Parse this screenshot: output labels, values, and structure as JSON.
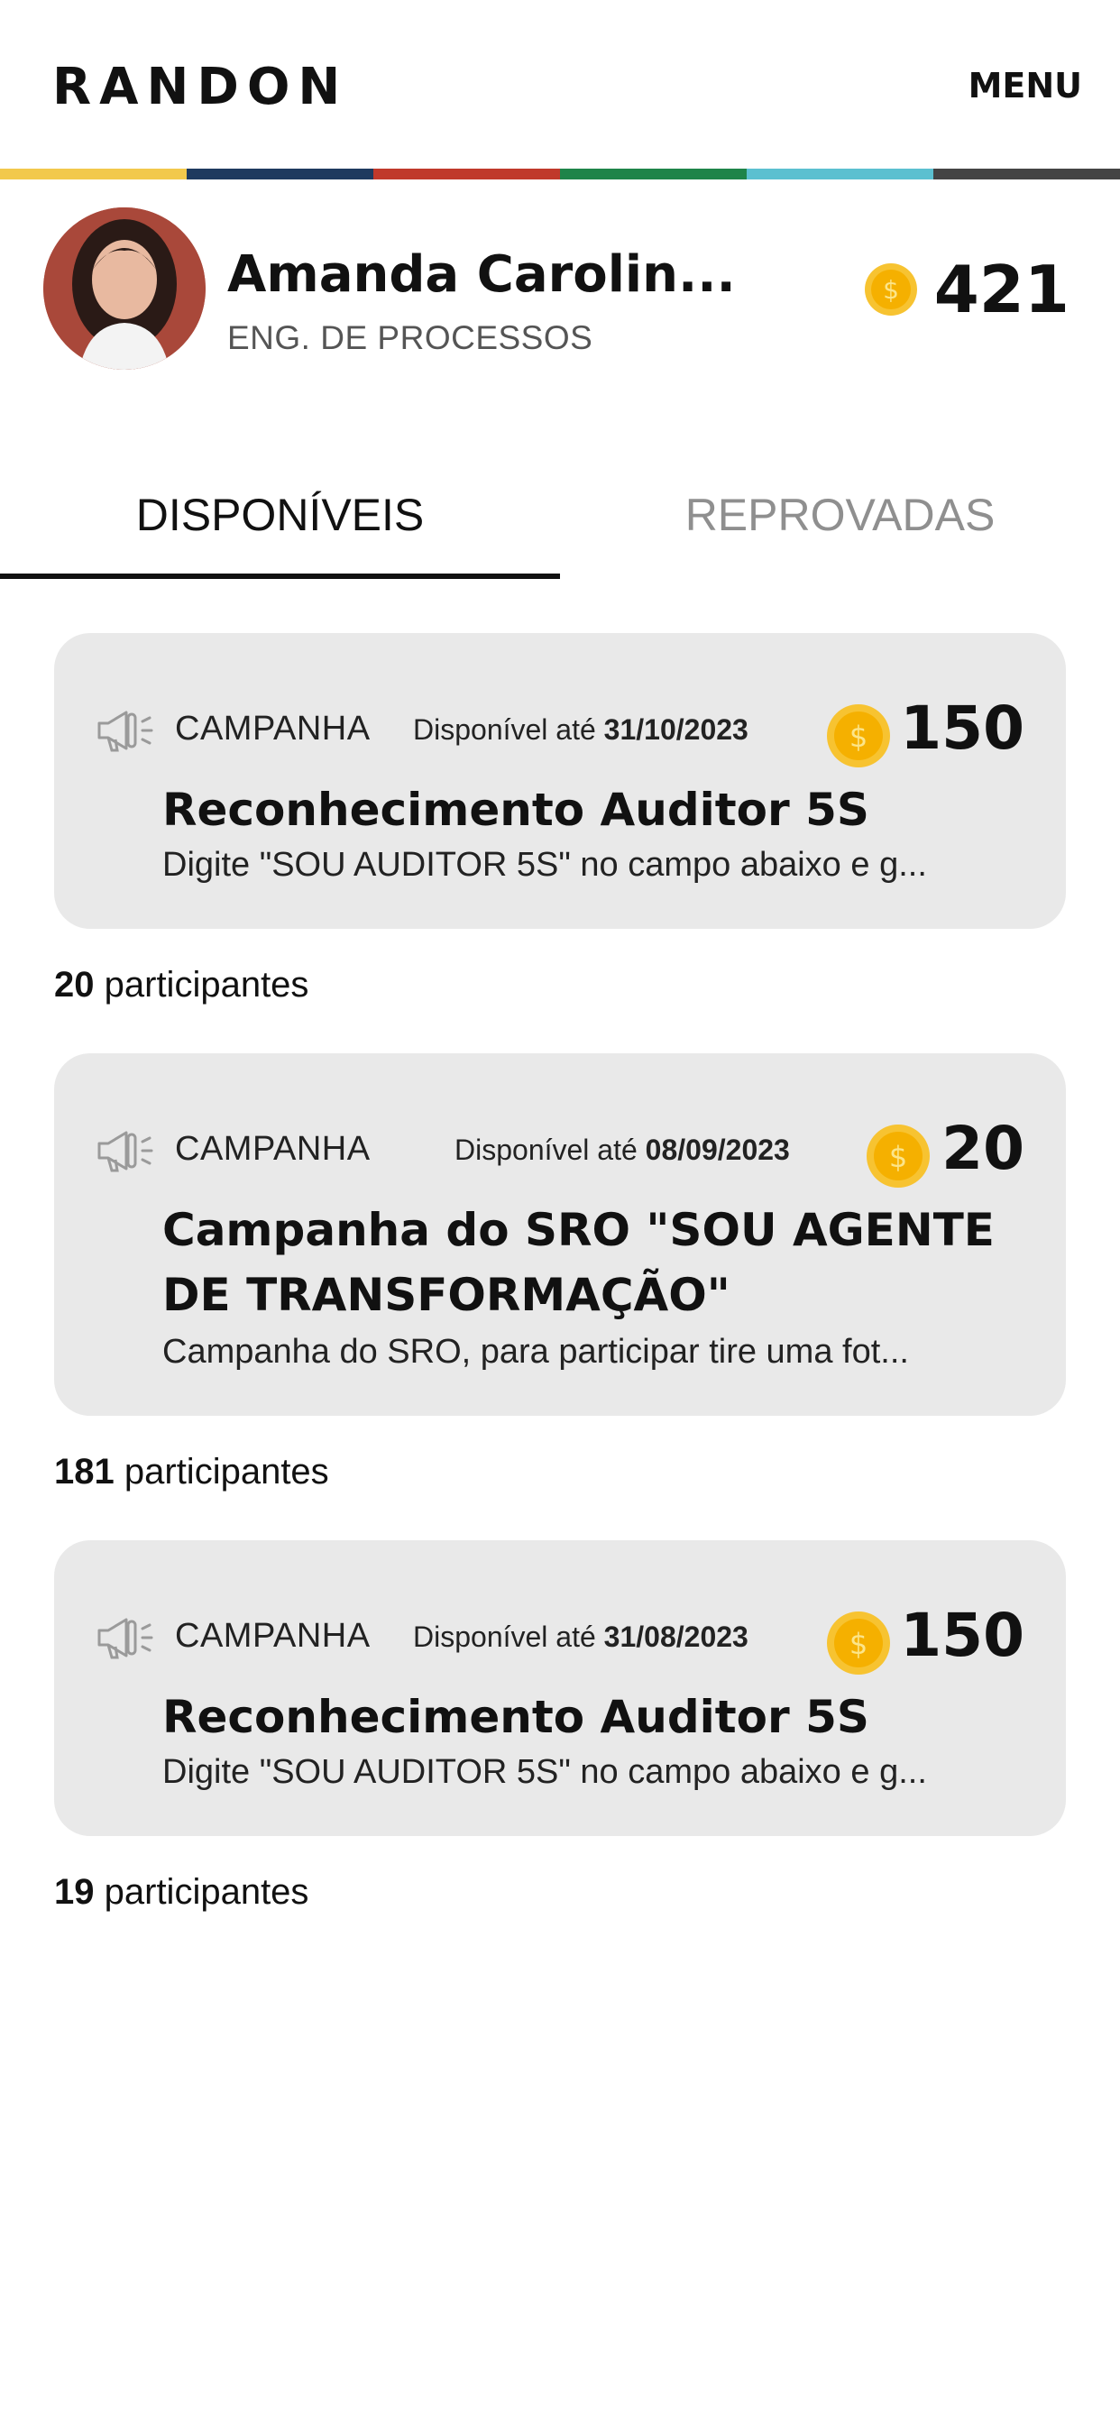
{
  "header": {
    "logo_text": "RANDON",
    "menu_label": "MENU",
    "color_bar": [
      "#f2c94c",
      "#1e3a5f",
      "#c0392b",
      "#1e8449",
      "#5bc0d0",
      "#444444"
    ]
  },
  "profile": {
    "name": "Amanda Carolin...",
    "role": "ENG. DE PROCESSOS",
    "coin_balance": "421"
  },
  "tabs": [
    {
      "label": "DISPONÍVEIS",
      "active": true
    },
    {
      "label": "REPROVADAS",
      "active": false
    }
  ],
  "campaigns": [
    {
      "type": "CAMPANHA",
      "available_prefix": "Disponível até",
      "available_date": "31/10/2023",
      "points": "150",
      "title": "Reconhecimento Auditor 5S",
      "description": "Digite \"SOU AUDITOR 5S\" no campo abaixo e g...",
      "participants_count": "20",
      "participants_label": "participantes"
    },
    {
      "type": "CAMPANHA",
      "available_prefix": "Disponível até",
      "available_date": "08/09/2023",
      "points": "20",
      "title": "Campanha do SRO \"SOU AGENTE DE TRANSFORMAÇÃO\"",
      "description": "Campanha do SRO, para participar tire uma fot...",
      "participants_count": "181",
      "participants_label": "participantes"
    },
    {
      "type": "CAMPANHA",
      "available_prefix": "Disponível até",
      "available_date": "31/08/2023",
      "points": "150",
      "title": "Reconhecimento Auditor 5S",
      "description": "Digite \"SOU AUDITOR 5S\" no campo abaixo e g...",
      "participants_count": "19",
      "participants_label": "participantes"
    }
  ],
  "colors": {
    "card_background": "#e9e9e9",
    "coin_gold": "#f5b800",
    "inactive_tab": "#8f8f8f"
  }
}
